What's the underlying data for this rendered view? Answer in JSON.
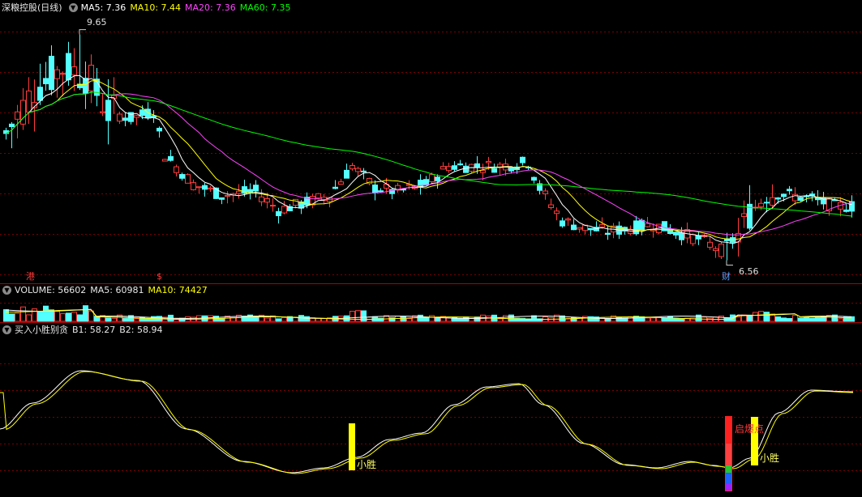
{
  "main_panel": {
    "title": "深粮控股(日线)",
    "indicators": [
      {
        "label": "MA5: 7.36",
        "color": "#ffffff"
      },
      {
        "label": "MA10: 7.44",
        "color": "#ffff00"
      },
      {
        "label": "MA20: 7.36",
        "color": "#ff44ff"
      },
      {
        "label": "MA60: 7.35",
        "color": "#00ff00"
      }
    ],
    "high_label": "9.65",
    "low_label": "6.56",
    "marker_gang": "港",
    "marker_s": "$",
    "marker_cai": "财"
  },
  "volume_panel": {
    "indicators": [
      {
        "label": "VOLUME: 56602",
        "color": "#e8e8e8"
      },
      {
        "label": "MA5: 60981",
        "color": "#e8e8e8"
      },
      {
        "label": "MA10: 74427",
        "color": "#ffff00"
      }
    ]
  },
  "signal_panel": {
    "title": "买入小胜别贪",
    "indicators": [
      {
        "label": "B1: 58.27",
        "color": "#e8e8e8"
      },
      {
        "label": "B2: 58.94",
        "color": "#e8e8e8"
      }
    ],
    "signal_label_1": "小胜",
    "signal_label_2": "小胜",
    "signal_label_start": "启爆点"
  },
  "colors": {
    "up": "#ff3b3b",
    "down": "#54ffff",
    "grid": "#8b0000",
    "ma5": "#ffffff",
    "ma10": "#ffff00",
    "ma20": "#ff44ff",
    "ma60": "#00ff00",
    "signal": "#ffff00"
  },
  "chart_data": {
    "type": "candlestick",
    "price_range": [
      6.3,
      9.9
    ],
    "high": 9.65,
    "low": 6.56,
    "ma_latest": {
      "MA5": 7.36,
      "MA10": 7.44,
      "MA20": 7.36,
      "MA60": 7.35
    },
    "volume_latest": 56602,
    "volume_ma": {
      "MA5": 60981,
      "MA10": 74427
    },
    "oscillator_latest": {
      "B1": 58.27,
      "B2": 58.94
    }
  }
}
